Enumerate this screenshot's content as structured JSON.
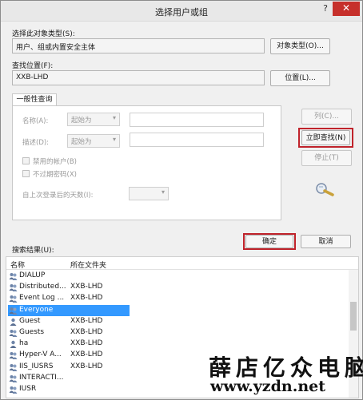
{
  "window": {
    "title": "选择用户或组",
    "help": "?",
    "close": "✕"
  },
  "object_type": {
    "label": "选择此对象类型(S):",
    "value": "用户、组或内置安全主体",
    "button": "对象类型(O)..."
  },
  "location": {
    "label": "查找位置(F):",
    "value": "XXB-LHD",
    "button": "位置(L)..."
  },
  "tab": {
    "label": "一般性查询"
  },
  "query": {
    "name_label": "名称(A):",
    "name_mode": "起始为",
    "desc_label": "描述(D):",
    "desc_mode": "起始为",
    "disabled_accounts": "禁用的帐户(B)",
    "non_expiring_pw": "不过期密码(X)",
    "days_label": "自上次登录后的天数(I):"
  },
  "buttons": {
    "columns": "列(C)...",
    "find_now": "立即查找(N)",
    "stop": "停止(T)",
    "ok": "确定",
    "cancel": "取消"
  },
  "results": {
    "label": "搜索结果(U):",
    "columns": [
      "名称",
      "所在文件夹"
    ],
    "rows": [
      {
        "name": "DIALUP",
        "folder": "",
        "icon": "group-icon"
      },
      {
        "name": "Distributed...",
        "folder": "XXB-LHD",
        "icon": "group-icon"
      },
      {
        "name": "Event Log ...",
        "folder": "XXB-LHD",
        "icon": "group-icon"
      },
      {
        "name": "Everyone",
        "folder": "",
        "icon": "group-icon",
        "selected": true
      },
      {
        "name": "Guest",
        "folder": "XXB-LHD",
        "icon": "user-icon"
      },
      {
        "name": "Guests",
        "folder": "XXB-LHD",
        "icon": "group-icon"
      },
      {
        "name": "ha",
        "folder": "XXB-LHD",
        "icon": "user-icon"
      },
      {
        "name": "Hyper-V A...",
        "folder": "XXB-LHD",
        "icon": "group-icon"
      },
      {
        "name": "IIS_IUSRS",
        "folder": "XXB-LHD",
        "icon": "group-icon"
      },
      {
        "name": "INTERACTI...",
        "folder": "",
        "icon": "group-icon"
      },
      {
        "name": "IUSR",
        "folder": "",
        "icon": "group-icon"
      }
    ]
  },
  "watermark": {
    "text": "薛店亿众电脑",
    "url": "www.yzdn.net"
  },
  "colors": {
    "highlight_box": "#c0232b",
    "selection": "#3399ff",
    "close": "#c6302b"
  }
}
